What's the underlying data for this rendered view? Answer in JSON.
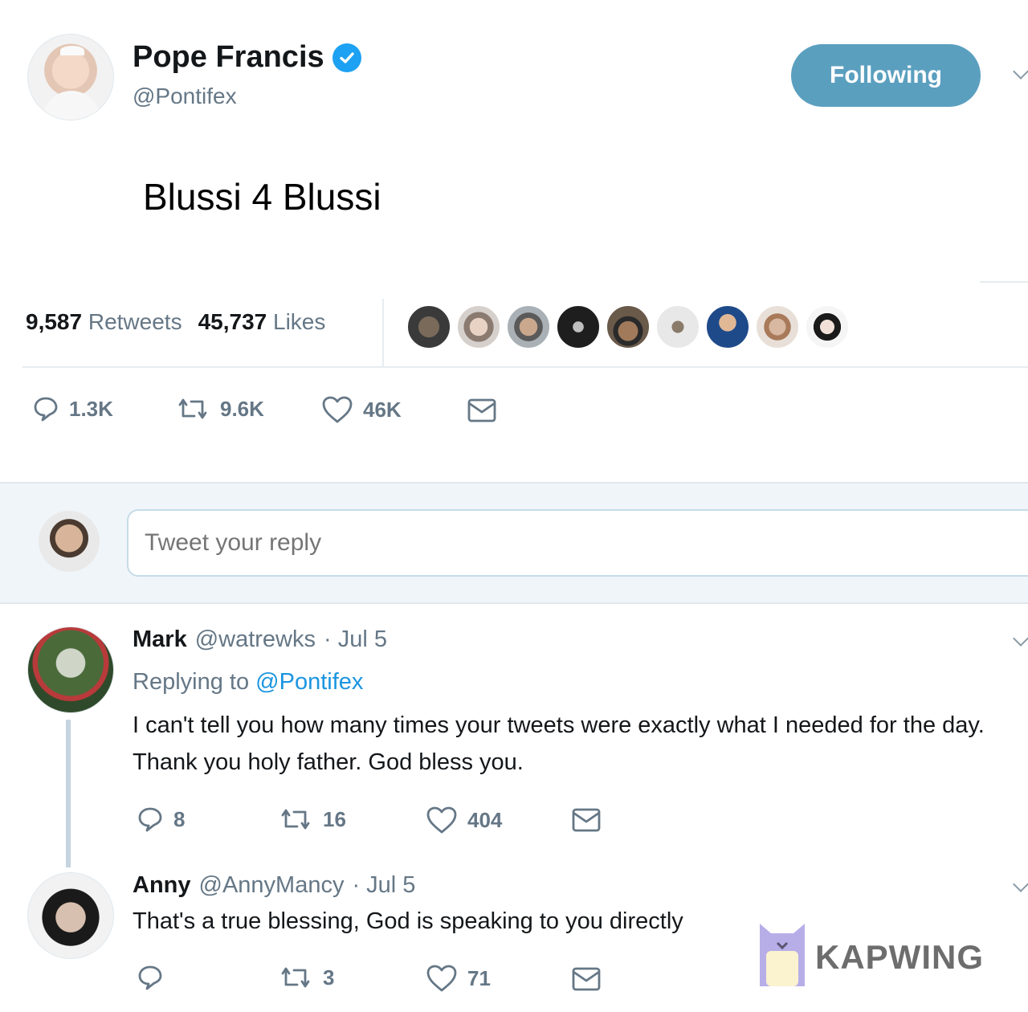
{
  "header": {
    "display_name": "Pope Francis",
    "handle": "@Pontifex",
    "follow_label": "Following"
  },
  "tweet": {
    "text": "Blussi 4 Blussi",
    "retweets_count": "9,587",
    "retweets_label": "Retweets",
    "likes_count": "45,737",
    "likes_label": "Likes",
    "actions": {
      "replies": "1.3K",
      "retweets": "9.6K",
      "likes": "46K"
    }
  },
  "reply_box": {
    "placeholder": "Tweet your reply"
  },
  "replies": [
    {
      "name": "Mark",
      "handle": "@watrewks",
      "date": "· Jul 5",
      "replying_prefix": "Replying to",
      "replying_to": "@Pontifex",
      "text": "I can't tell you how many times your tweets were exactly what I needed for the day. Thank you holy father. God bless you.",
      "replies": "8",
      "retweets": "16",
      "likes": "404"
    },
    {
      "name": "Anny",
      "handle": "@AnnyMancy",
      "date": "· Jul 5",
      "text": "That's a true blessing, God is speaking to you directly",
      "replies": "",
      "retweets": "3",
      "likes": "71"
    }
  ],
  "watermark": {
    "text": "KAPWING"
  },
  "colors": {
    "accent": "#1da1f2",
    "follow_button": "#5b9fbf",
    "muted_text": "#657786",
    "reply_band": "#f0f5f9"
  }
}
